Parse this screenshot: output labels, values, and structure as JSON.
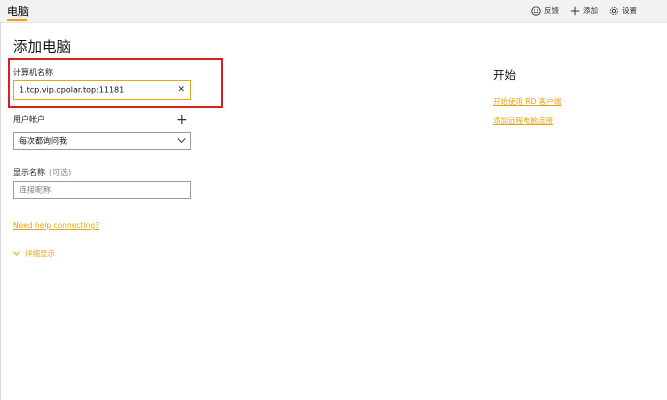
{
  "app": {
    "title": "电脑",
    "accent_color": "#e8a317"
  },
  "topbar": {
    "actions": [
      {
        "icon": "smiley-icon",
        "label": "反馈"
      },
      {
        "icon": "plus-icon",
        "label": "添加"
      },
      {
        "icon": "gear-icon",
        "label": "设置"
      }
    ]
  },
  "form": {
    "title": "添加电脑",
    "pc_name_label": "计算机名称",
    "pc_name_value": "1.tcp.vip.cpolar.top:11181",
    "user_account_label": "用户帐户",
    "user_account_selected": "每次都询问我",
    "display_name_label": "显示名称",
    "display_name_hint": "(可选)",
    "display_name_placeholder": "连接昵称",
    "help_link": "Need help connecting?",
    "show_details": "详细显示"
  },
  "start": {
    "title": "开始",
    "links": [
      "开始使用 RD 客户端",
      "添加远程电脑连接"
    ]
  },
  "highlight_color": "#d62020"
}
